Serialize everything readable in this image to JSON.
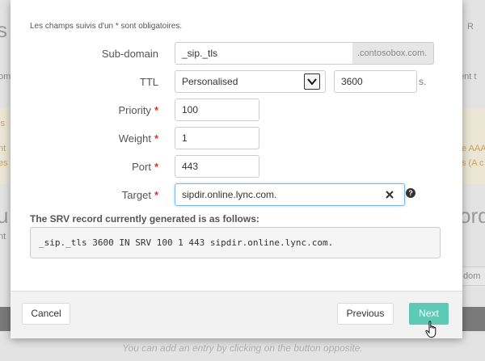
{
  "background": {
    "left_letter": "s",
    "right_tab_letter": "R",
    "left_snippet_1": "om",
    "right_snippet_1": "ent t",
    "warn_left_1": "is",
    "warn_left_2": "nt",
    "warn_left_3": "es",
    "warn_right_1": "e AAA",
    "warn_right_2": "s (A c",
    "left_big": "u",
    "left_snippet_2": "nt",
    "right_big": "ord",
    "right_input": "dom",
    "footer_note": "You can add an entry by clicking on the button opposite."
  },
  "form": {
    "required_note": "Les champs suivis d'un * sont obligatoires.",
    "subdomain": {
      "label": "Sub-domain",
      "value": "_sip._tls",
      "suffix": ".contosobox.com."
    },
    "ttl": {
      "label": "TTL",
      "selected": "Personalised",
      "value": "3600",
      "unit": "s."
    },
    "priority": {
      "label": "Priority",
      "required": "*",
      "value": "100"
    },
    "weight": {
      "label": "Weight",
      "required": "*",
      "value": "1"
    },
    "port": {
      "label": "Port",
      "required": "*",
      "value": "443"
    },
    "target": {
      "label": "Target",
      "required": "*",
      "value": "sipdir.online.lync.com."
    },
    "help": "?"
  },
  "record": {
    "heading": "The SRV record currently generated is as follows:",
    "value": "_sip._tls 3600 IN SRV 100 1 443 sipdir.online.lync.com."
  },
  "footer": {
    "cancel": "Cancel",
    "previous": "Previous",
    "next": "Next"
  },
  "colors": {
    "accent": "#5ec9b4",
    "required": "#d9332b",
    "focus": "#7fb9e6"
  }
}
